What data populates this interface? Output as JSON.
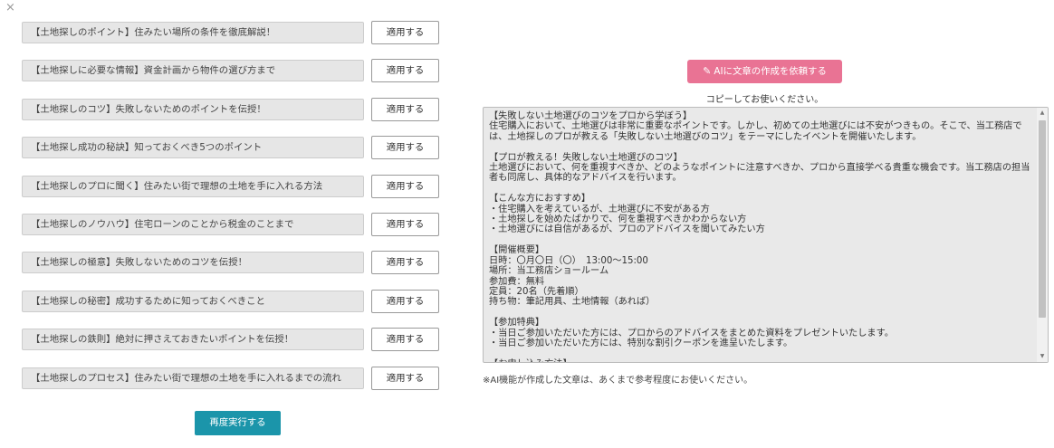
{
  "close_glyph": "×",
  "titles": [
    {
      "text": "【土地探しのポイント】住みたい場所の条件を徹底解説！",
      "apply": "適用する"
    },
    {
      "text": "【土地探しに必要な情報】資金計画から物件の選び方まで",
      "apply": "適用する"
    },
    {
      "text": "【土地探しのコツ】失敗しないためのポイントを伝授！",
      "apply": "適用する"
    },
    {
      "text": "【土地探し成功の秘訣】知っておくべき5つのポイント",
      "apply": "適用する"
    },
    {
      "text": "【土地探しのプロに聞く】住みたい街で理想の土地を手に入れる方法",
      "apply": "適用する"
    },
    {
      "text": "【土地探しのノウハウ】住宅ローンのことから税金のことまで",
      "apply": "適用する"
    },
    {
      "text": "【土地探しの極意】失敗しないためのコツを伝授！",
      "apply": "適用する"
    },
    {
      "text": "【土地探しの秘密】成功するために知っておくべきこと",
      "apply": "適用する"
    },
    {
      "text": "【土地探しの鉄則】絶対に押さえておきたいポイントを伝授！",
      "apply": "適用する"
    },
    {
      "text": "【土地探しのプロセス】住みたい街で理想の土地を手に入れるまでの流れ",
      "apply": "適用する"
    }
  ],
  "rerun_label": "再度実行する",
  "ai_button_label": "AIに文章の作成を依頼する",
  "copy_hint": "コピーしてお使いください。",
  "result_text": "【失敗しない土地選びのコツをプロから学ぼう】\n住宅購入において、土地選びは非常に重要なポイントです。しかし、初めての土地選びには不安がつきもの。そこで、当工務店では、土地探しのプロが教える「失敗しない土地選びのコツ」をテーマにしたイベントを開催いたします。\n\n【プロが教える！失敗しない土地選びのコツ】\n土地選びにおいて、何を重視すべきか、どのようなポイントに注意すべきか、プロから直接学べる貴重な機会です。当工務店の担当者も同席し、具体的なアドバイスを行います。\n\n【こんな方におすすめ】\n・住宅購入を考えているが、土地選びに不安がある方\n・土地探しを始めたばかりで、何を重視すべきかわからない方\n・土地選びには自信があるが、プロのアドバイスを聞いてみたい方\n\n【開催概要】\n日時：〇月〇日（〇）　13:00～15:00\n場所：当工務店ショールーム\n参加費：無料\n定員：20名（先着順）\n持ち物：筆記用具、土地情報（あれば）\n\n【参加特典】\n・当日ご参加いただいた方には、プロからのアドバイスをまとめた資料をプレゼントいたします。\n・当日ご参加いただいた方には、特別な割引クーポンを進呈いたします。\n\n【お申し込み方法】\n下記のフォームよりお申し込みください。\n※定員に達し次第、締め切らせていただきます。",
  "ai_note": "※AI機能が作成した文章は、あくまで参考程度にお使いください。",
  "icons": {
    "ai_button": "magic-wand-icon",
    "close": "close-icon"
  }
}
